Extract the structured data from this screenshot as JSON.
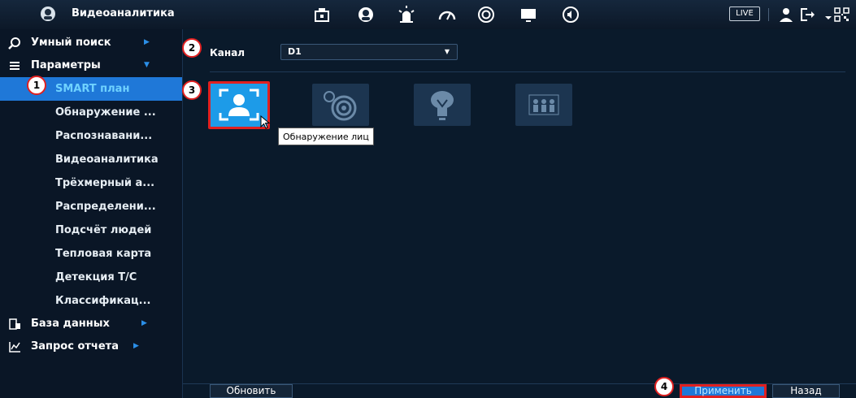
{
  "topbar": {
    "title": "Видеоаналитика",
    "live_label": "LIVE",
    "icons": [
      "camera-icon",
      "face-icon",
      "alarm-icon",
      "gauge-icon",
      "record-icon",
      "monitor-icon",
      "audio-icon"
    ]
  },
  "sidebar": {
    "smart_search": "Умный поиск",
    "parameters": "Параметры",
    "sub_items": [
      "SMART план",
      "Обнаружение ...",
      "Распознавани...",
      "Видеоаналитика",
      "Трёхмерный а...",
      "Распределени...",
      "Подсчёт людей",
      "Тепловая карта",
      "Детекция Т/С",
      "Классификац..."
    ],
    "database": "База данных",
    "report": "Запрос отчета"
  },
  "main": {
    "channel_label": "Канал",
    "channel_value": "D1",
    "tooltip": "Обнаружение лиц",
    "refresh_button": "Обновить",
    "apply_button": "Применить",
    "back_button": "Назад"
  },
  "badges": [
    "1",
    "2",
    "3",
    "4"
  ],
  "colors": {
    "accent": "#1f78d8",
    "highlight_border": "#e02020",
    "background": "#0a1a2b"
  }
}
